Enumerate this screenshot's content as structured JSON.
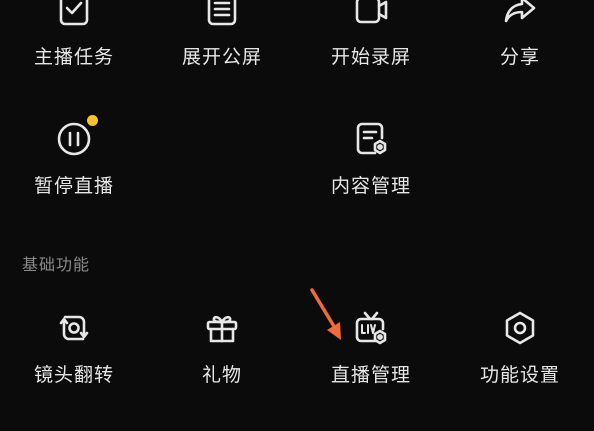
{
  "colors": {
    "background": "#0b0b0b",
    "text": "#e7e7e7",
    "muted": "#8a8a8a",
    "badge": "#f6c22e",
    "arrow": "#f26a3c"
  },
  "row1": [
    {
      "label": "主播任务",
      "icon": "task-checklist-icon"
    },
    {
      "label": "展开公屏",
      "icon": "list-document-icon"
    },
    {
      "label": "开始录屏",
      "icon": "screen-record-icon"
    },
    {
      "label": "分享",
      "icon": "share-arrow-icon"
    }
  ],
  "row2": [
    {
      "label": "暂停直播",
      "icon": "pause-circle-icon"
    },
    {
      "label": "内容管理",
      "icon": "content-settings-icon"
    }
  ],
  "section": {
    "title": "基础功能"
  },
  "row3": [
    {
      "label": "镜头翻转",
      "icon": "camera-flip-icon"
    },
    {
      "label": "礼物",
      "icon": "gift-icon"
    },
    {
      "label": "直播管理",
      "icon": "live-tv-settings-icon"
    },
    {
      "label": "功能设置",
      "icon": "hexagon-settings-icon"
    }
  ]
}
